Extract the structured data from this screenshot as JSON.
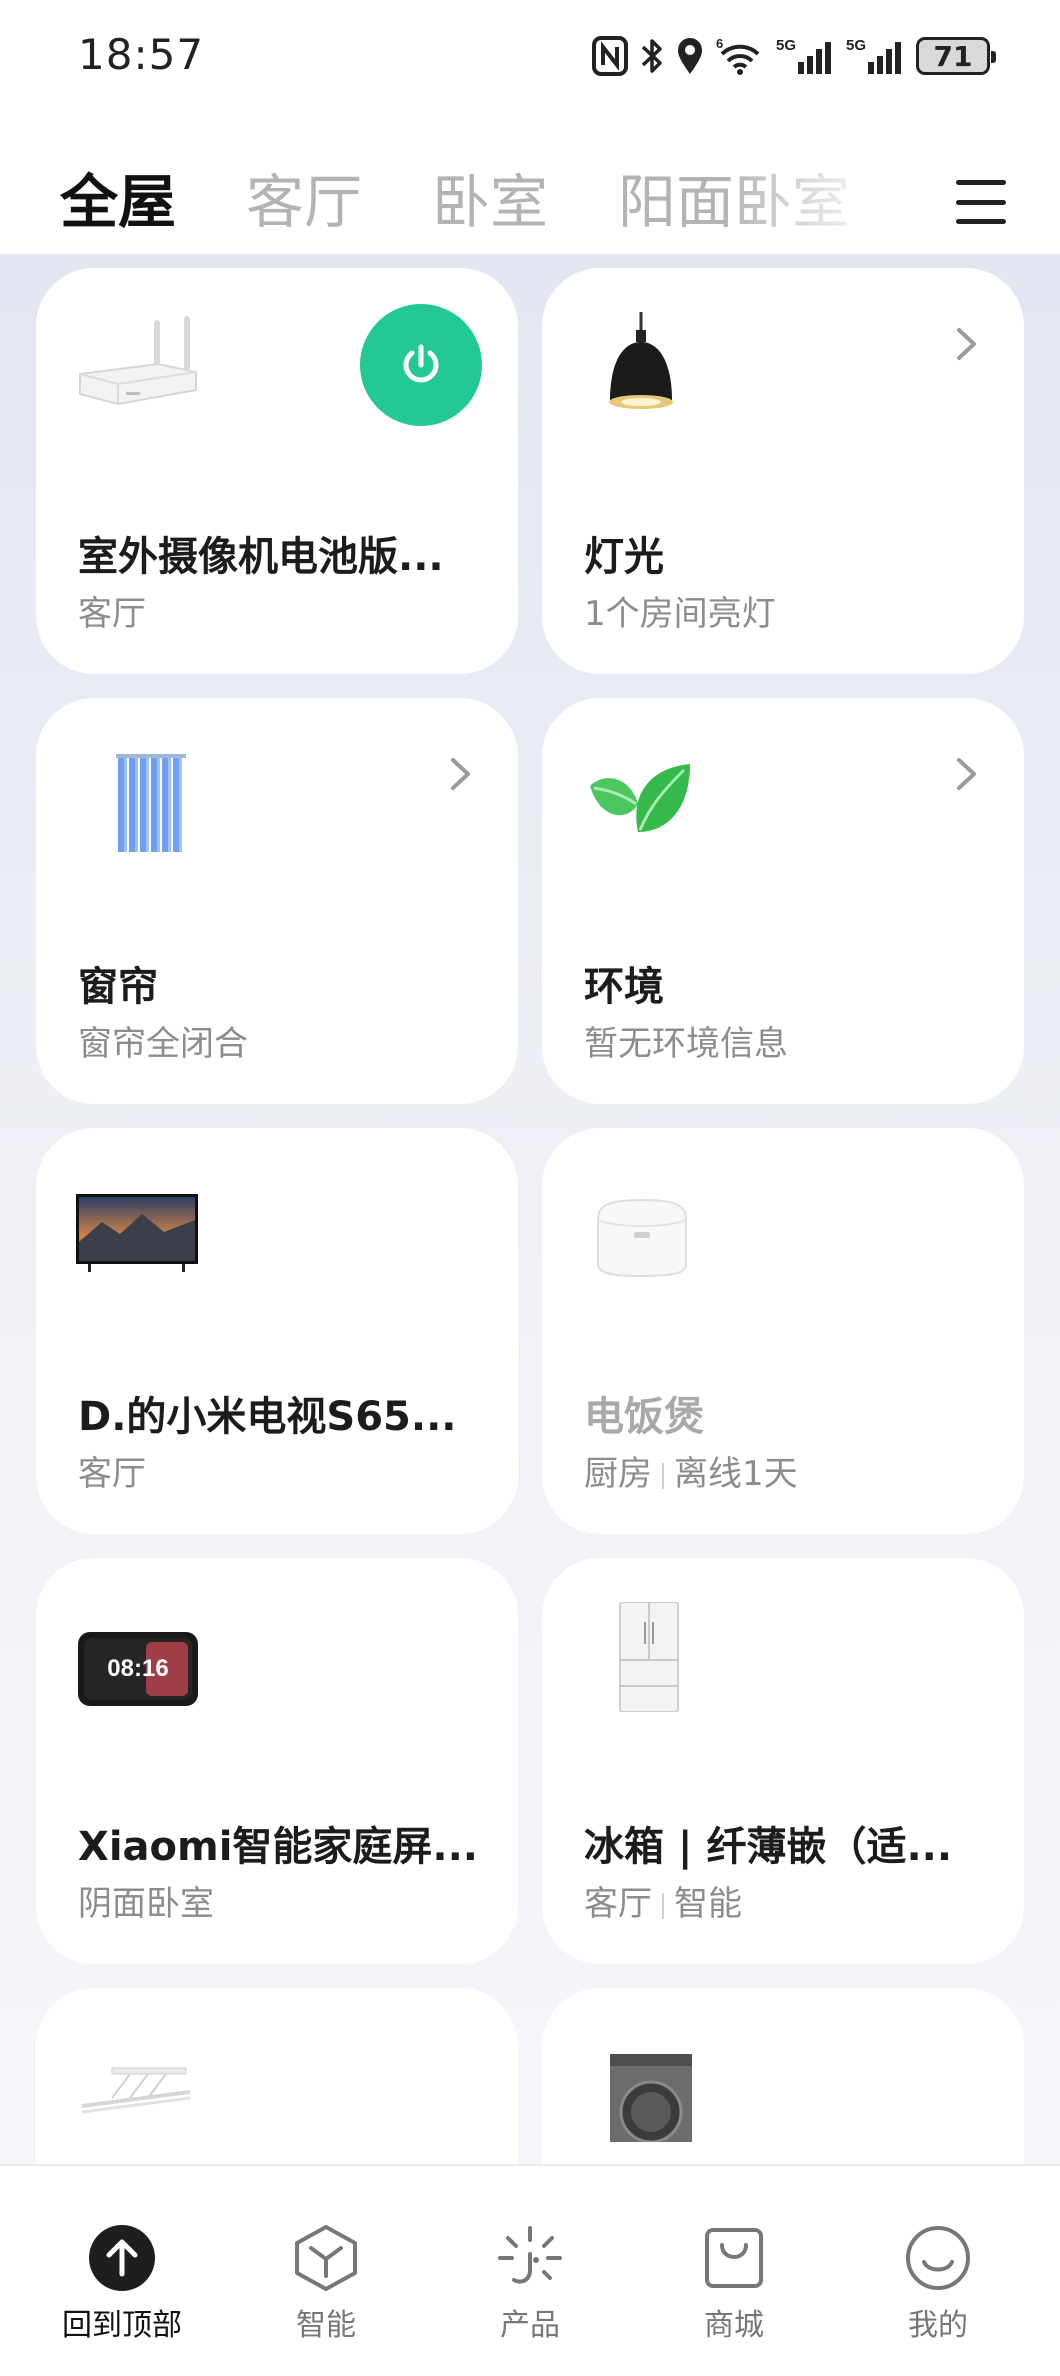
{
  "status_bar": {
    "time": "18:57",
    "battery": "71",
    "icons": [
      "nfc-icon",
      "bluetooth-icon",
      "location-icon",
      "wifi-icon",
      "signal-5g-icon",
      "signal-5g-icon"
    ]
  },
  "tabs": [
    {
      "label": "全屋",
      "active": true
    },
    {
      "label": "客厅",
      "active": false
    },
    {
      "label": "卧室",
      "active": false
    },
    {
      "label": "阳面卧室",
      "active": false
    }
  ],
  "menu_icon": "hamburger-menu-icon",
  "cards": [
    {
      "title": "室外摄像机电池版...",
      "subtitle": "客厅",
      "image": "router-device-icon",
      "action": "power-button"
    },
    {
      "title": "灯光",
      "subtitle": "1个房间亮灯",
      "image": "pendant-lamp-icon",
      "action": "chevron"
    },
    {
      "title": "窗帘",
      "subtitle": "窗帘全闭合",
      "image": "curtain-icon",
      "action": "chevron"
    },
    {
      "title": "环境",
      "subtitle": "暂无环境信息",
      "image": "leaf-icon",
      "action": "chevron"
    },
    {
      "title": "D.的小米电视S65...",
      "subtitle": "客厅",
      "image": "tv-icon"
    },
    {
      "title": "电饭煲",
      "subtitle_parts": [
        "厨房",
        "离线1天"
      ],
      "image": "rice-cooker-icon",
      "offline": true
    },
    {
      "title": "Xiaomi智能家庭屏...",
      "subtitle": "阴面卧室",
      "image": "smart-display-icon",
      "display_time": "08:16"
    },
    {
      "title": "冰箱 | 纤薄嵌（适...",
      "subtitle_parts": [
        "客厅",
        "智能"
      ],
      "image": "refrigerator-icon"
    },
    {
      "image": "drying-rack-icon"
    },
    {
      "image": "washing-machine-icon"
    }
  ],
  "colors": {
    "power_green": "#22c995",
    "active_tab": "#111111",
    "inactive_tab": "#b3b3b3"
  },
  "bottom_nav": [
    {
      "label": "回到顶部",
      "icon": "arrow-up-icon",
      "active": true
    },
    {
      "label": "智能",
      "icon": "cube-icon"
    },
    {
      "label": "产品",
      "icon": "sparkle-icon"
    },
    {
      "label": "商城",
      "icon": "shopping-bag-icon"
    },
    {
      "label": "我的",
      "icon": "smile-icon"
    }
  ]
}
